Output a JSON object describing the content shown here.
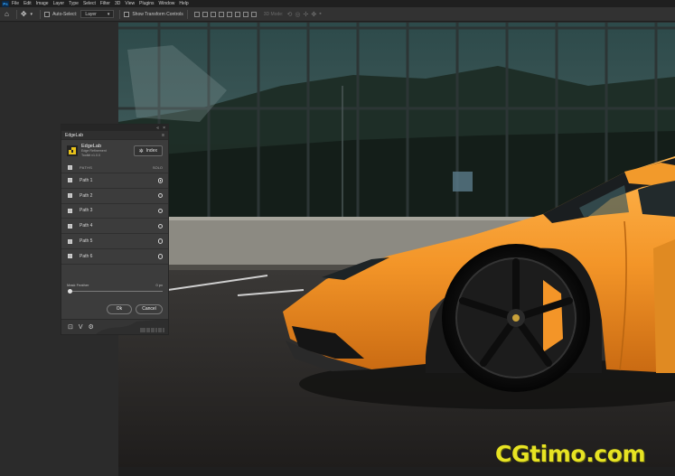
{
  "app": {
    "logo_text": "Ps"
  },
  "menu": [
    "File",
    "Edit",
    "Image",
    "Layer",
    "Type",
    "Select",
    "Filter",
    "3D",
    "View",
    "Plugins",
    "Window",
    "Help"
  ],
  "options_bar": {
    "auto_select_label": "Auto-Select:",
    "auto_select_value": "Layer",
    "transform_label": "Show Transform Controls",
    "mode_3d_label": "3D Mode:"
  },
  "panel": {
    "tab_title": "EdgeLab",
    "brand_name": "EdgeLab",
    "brand_sub1": "Edge Refinement",
    "brand_sub2": "Toolkit v1.0.0",
    "index_label": "Index",
    "col_paths": "PATHS",
    "col_solo": "SOLO",
    "paths": [
      {
        "label": "Path 1",
        "solo": true
      },
      {
        "label": "Path 2",
        "solo": false
      },
      {
        "label": "Path 3",
        "solo": false
      },
      {
        "label": "Path 4",
        "solo": false
      },
      {
        "label": "Path 5",
        "solo": false
      },
      {
        "label": "Path 6",
        "solo": false
      }
    ],
    "feather_label": "Mask Feather",
    "feather_value": "0 px",
    "feather_level": 0,
    "ok_label": "Ok",
    "cancel_label": "Cancel"
  },
  "watermark": "CGtimo.com",
  "colors": {
    "car": "#f59a2b",
    "panel_bg": "#3c3c3c",
    "watermark": "#e7e323"
  }
}
